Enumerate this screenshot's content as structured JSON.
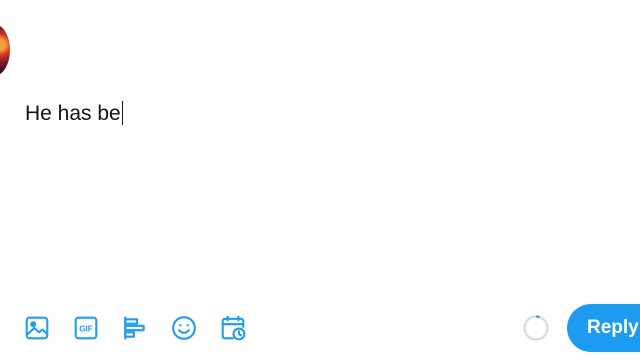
{
  "composer": {
    "text": "He has be"
  },
  "toolbar": {
    "items": [
      {
        "icon": "image-icon"
      },
      {
        "icon": "gif-icon",
        "label": "GIF"
      },
      {
        "icon": "poll-icon"
      },
      {
        "icon": "emoji-icon"
      },
      {
        "icon": "schedule-icon"
      }
    ]
  },
  "reply_button": {
    "label": "Reply"
  },
  "colors": {
    "accent": "#1d9bf0",
    "text": "#0f1419",
    "progress_track": "#cfd9de"
  },
  "character_progress": 0.05
}
